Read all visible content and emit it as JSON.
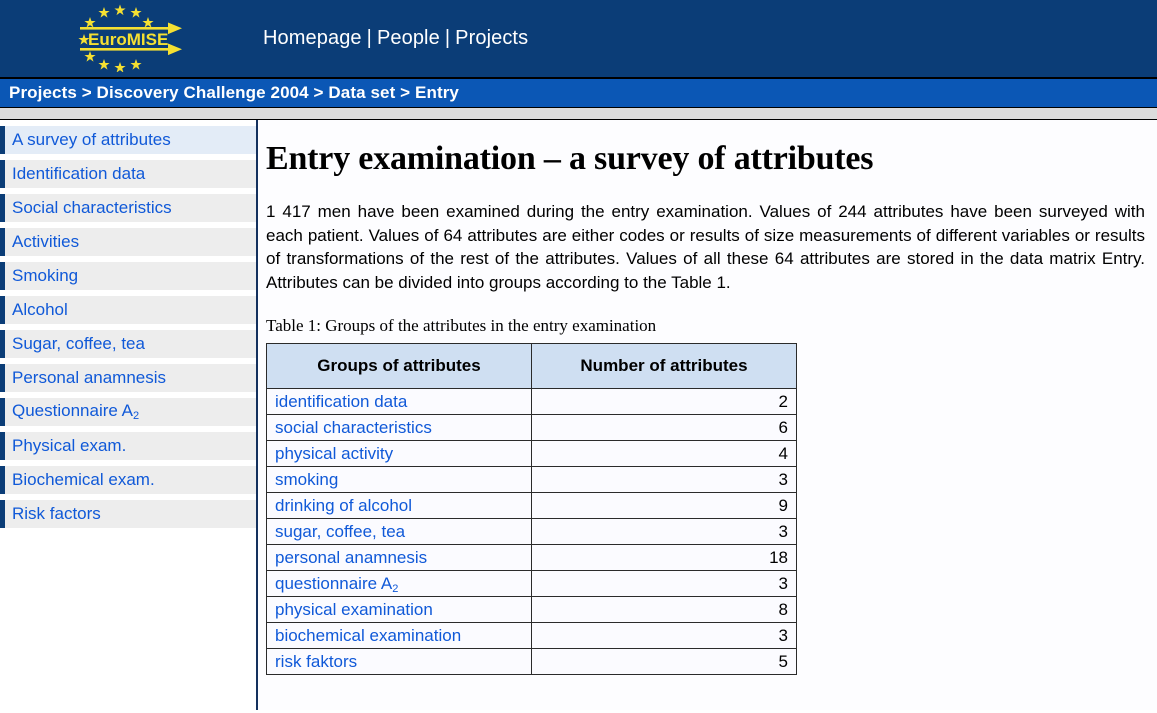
{
  "header": {
    "logo_text": "EuroMISE",
    "nav": [
      {
        "label": "Homepage"
      },
      {
        "label": "People"
      },
      {
        "label": "Projects"
      }
    ],
    "nav_separator": "|"
  },
  "breadcrumb": {
    "text": "Projects > Discovery Challenge 2004 > Data set > Entry"
  },
  "sidebar": {
    "items": [
      {
        "label": "A survey of attributes",
        "active": true
      },
      {
        "label": "Identification data",
        "active": false
      },
      {
        "label": "Social characteristics",
        "active": false
      },
      {
        "label": "Activities",
        "active": false
      },
      {
        "label": "Smoking",
        "active": false
      },
      {
        "label": "Alcohol",
        "active": false
      },
      {
        "label": "Sugar, coffee, tea",
        "active": false
      },
      {
        "label": "Personal anamnesis",
        "active": false
      },
      {
        "label": "Questionnaire A",
        "sub": "2",
        "active": false
      },
      {
        "label": "Physical exam.",
        "active": false
      },
      {
        "label": "Biochemical exam.",
        "active": false
      },
      {
        "label": "Risk factors",
        "active": false
      }
    ]
  },
  "main": {
    "title": "Entry examination – a survey of attributes",
    "intro": "1 417 men have been examined during the entry examination. Values of 244 attributes have been surveyed with each patient. Values of 64 attributes are either codes or results of size measurements of different variables or results of transformations of the rest of the attributes. Values of all these 64 attributes are stored in the data matrix Entry. Attributes can be divided into groups according to the Table 1.",
    "table_caption": "Table 1: Groups of the attributes in the entry examination",
    "table": {
      "columns": [
        "Groups of attributes",
        "Number of attributes"
      ],
      "rows": [
        {
          "group": "identification data",
          "count": "2"
        },
        {
          "group": "social characteristics",
          "count": "6"
        },
        {
          "group": "physical activity",
          "count": "4"
        },
        {
          "group": "smoking",
          "count": "3"
        },
        {
          "group": "drinking of alcohol",
          "count": "9"
        },
        {
          "group": "sugar, coffee, tea",
          "count": "3"
        },
        {
          "group": "personal anamnesis",
          "count": "18"
        },
        {
          "group": "questionnaire A",
          "sub": "2",
          "count": "3"
        },
        {
          "group": "physical examination",
          "count": "8"
        },
        {
          "group": "biochemical examination",
          "count": "3"
        },
        {
          "group": "risk faktors",
          "count": "5"
        }
      ]
    }
  },
  "colors": {
    "banner": "#0b3d77",
    "breadcrumb": "#0b57b5",
    "link": "#1059d8",
    "table_header": "#cfdff2",
    "logo_yellow": "#f5e032"
  }
}
